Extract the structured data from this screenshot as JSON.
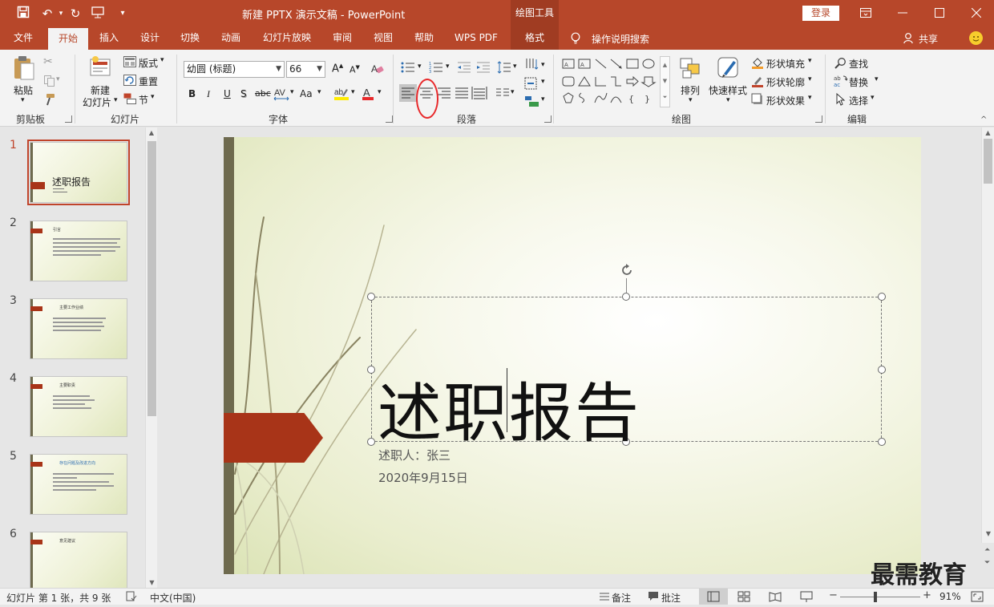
{
  "app": {
    "title": "新建 PPTX 演示文稿  -  PowerPoint",
    "context_tab": "绘图工具",
    "login_label": "登录"
  },
  "tabs": [
    {
      "label": "文件"
    },
    {
      "label": "开始"
    },
    {
      "label": "插入"
    },
    {
      "label": "设计"
    },
    {
      "label": "切换"
    },
    {
      "label": "动画"
    },
    {
      "label": "幻灯片放映"
    },
    {
      "label": "审阅"
    },
    {
      "label": "视图"
    },
    {
      "label": "帮助"
    },
    {
      "label": "WPS PDF"
    },
    {
      "label": "格式"
    }
  ],
  "tell_me": "操作说明搜索",
  "share": "共享",
  "ribbon": {
    "clipboard": {
      "label": "剪贴板",
      "paste": "粘贴"
    },
    "slides": {
      "label": "幻灯片",
      "new_slide_1": "新建",
      "new_slide_2": "幻灯片",
      "layout": "版式",
      "reset": "重置",
      "section": "节"
    },
    "font": {
      "label": "字体",
      "font_name": "幼圆 (标题)",
      "font_size": "66",
      "bold": "B",
      "italic": "I",
      "underline": "U",
      "shadow": "S",
      "strike": "abc",
      "case": "Aa"
    },
    "paragraph": {
      "label": "段落"
    },
    "drawing": {
      "label": "绘图",
      "arrange": "排列",
      "quick_styles": "快速样式",
      "fill": "形状填充",
      "outline": "形状轮廓",
      "effects": "形状效果"
    },
    "editing": {
      "label": "编辑",
      "find": "查找",
      "replace": "替换",
      "select": "选择"
    }
  },
  "thumbnails": [
    {
      "num": "1",
      "title": "述职报告"
    },
    {
      "num": "2",
      "title": "引言"
    },
    {
      "num": "3",
      "title": "主要工作业绩"
    },
    {
      "num": "4",
      "title": "主要职责"
    },
    {
      "num": "5",
      "title": "存在问题及改进方向"
    },
    {
      "num": "6",
      "title": "意见建议"
    }
  ],
  "slide": {
    "title": "述职报告",
    "subtitle_1": "述职人：张三",
    "subtitle_2": "2020年9月15日"
  },
  "status": {
    "slide_info": "幻灯片 第 1 张，共 9 张",
    "language": "中文(中国)",
    "notes": "备注",
    "comments": "批注",
    "zoom": "91%"
  },
  "watermark": "最需教育",
  "colors": {
    "accent": "#b7472a",
    "slide_arrow": "#a83418",
    "slide_bar": "#6e6a4e",
    "highlight_circle": "#e8292b"
  }
}
